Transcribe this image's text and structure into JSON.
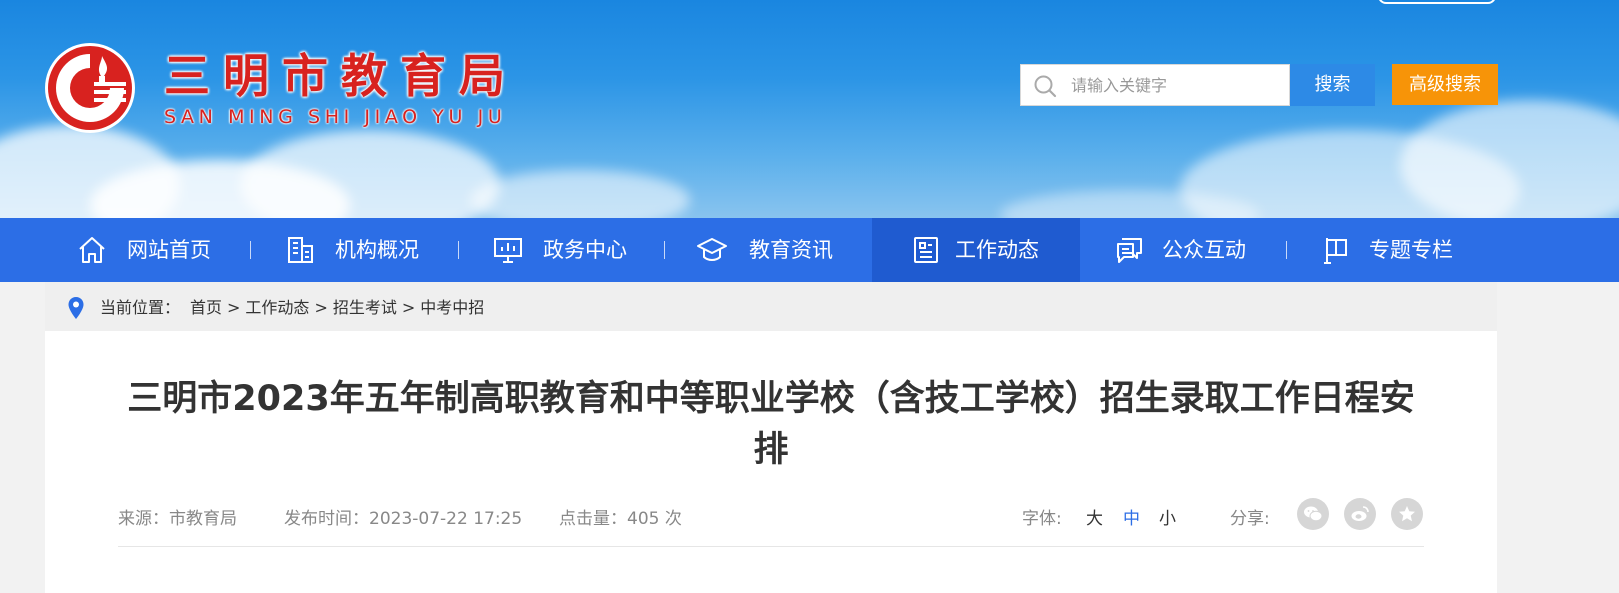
{
  "header": {
    "title": "三明市教育局",
    "subtitle": "SAN MING SHI JIAO YU JU",
    "search": {
      "placeholder": "请输入关键字",
      "button_label": "搜索",
      "advanced_label": "高级搜索"
    }
  },
  "nav": {
    "items": [
      {
        "label": "网站首页",
        "icon": "home-icon"
      },
      {
        "label": "机构概况",
        "icon": "building-icon"
      },
      {
        "label": "政务中心",
        "icon": "presentation-icon"
      },
      {
        "label": "教育资讯",
        "icon": "graduation-cap-icon"
      },
      {
        "label": "工作动态",
        "icon": "document-icon"
      },
      {
        "label": "公众互动",
        "icon": "chat-icon"
      },
      {
        "label": "专题专栏",
        "icon": "flag-icon"
      }
    ],
    "active_index": 4
  },
  "breadcrumb": {
    "label": "当前位置：",
    "items": [
      "首页",
      "工作动态",
      "招生考试",
      "中考中招"
    ],
    "separator": ">"
  },
  "article": {
    "title": "三明市2023年五年制高职教育和中等职业学校（含技工学校）招生录取工作日程安排",
    "source": "来源：市教育局",
    "published": "发布时间：2023-07-22 17:25",
    "views": "点击量：405 次"
  },
  "font_size": {
    "label": "字体:",
    "options": [
      "大",
      "中",
      "小"
    ],
    "selected": "中"
  },
  "share": {
    "label": "分享:",
    "targets": [
      "wechat-icon",
      "weibo-icon",
      "favorite-icon"
    ]
  },
  "colors": {
    "brand_red": "#d8221f",
    "nav_blue": "#2c6ee6",
    "search_blue": "#2d8ae6",
    "advanced_orange": "#f79408"
  }
}
